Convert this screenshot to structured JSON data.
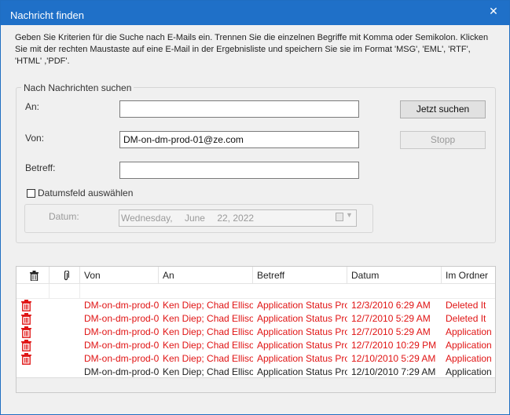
{
  "window": {
    "title": "Nachricht finden",
    "close_glyph": "✕"
  },
  "instructions": "Geben Sie Kriterien für die Suche nach E-Mails ein. Trennen Sie die einzelnen Begriffe mit Komma oder Semikolon. Klicken Sie mit der rechten Maustaste auf eine E-Mail in der Ergebnisliste und speichern Sie sie im Format 'MSG', 'EML', 'RTF', 'HTML' ,'PDF'.",
  "search": {
    "group_label": "Nach Nachrichten suchen",
    "to_label": "An:",
    "to_value": "",
    "from_label": "Von:",
    "from_value": "DM-on-dm-prod-01@ze.com",
    "subject_label": "Betreff:",
    "subject_value": "",
    "date_checkbox_label": "Datumsfeld auswählen",
    "date_checked": false,
    "date_label": "Datum:",
    "date_weekday": "Wednesday,",
    "date_month": "June",
    "date_day_year": "22, 2022",
    "search_button": "Jetzt suchen",
    "stop_button": "Stopp"
  },
  "results": {
    "columns": [
      "Von",
      "An",
      "Betreff",
      "Datum",
      "Im Ordner"
    ],
    "colors": {
      "deleted": "#e01414",
      "normal": "#222222"
    },
    "rows": [
      {
        "deleted": true,
        "from": "DM-on-dm-prod-0...",
        "to": "Ken Diep; Chad Elliso...",
        "subject": "Application Status Pro...",
        "date": "12/3/2010 6:29 AM",
        "folder": "Deleted It"
      },
      {
        "deleted": true,
        "from": "DM-on-dm-prod-0...",
        "to": "Ken Diep; Chad Elliso...",
        "subject": "Application Status Pro...",
        "date": "12/7/2010 5:29 AM",
        "folder": "Deleted It"
      },
      {
        "deleted": true,
        "from": "DM-on-dm-prod-0...",
        "to": "Ken Diep; Chad Elliso...",
        "subject": "Application Status Pro...",
        "date": "12/7/2010 5:29 AM",
        "folder": "Application"
      },
      {
        "deleted": true,
        "from": "DM-on-dm-prod-0...",
        "to": "Ken Diep; Chad Elliso...",
        "subject": "Application Status Pro...",
        "date": "12/7/2010 10:29 PM",
        "folder": "Application"
      },
      {
        "deleted": true,
        "from": "DM-on-dm-prod-0...",
        "to": "Ken Diep; Chad Elliso...",
        "subject": "Application Status Pro...",
        "date": "12/10/2010 5:29 AM",
        "folder": "Application"
      },
      {
        "deleted": false,
        "from": "DM-on-dm-prod-0...",
        "to": "Ken Diep; Chad Elliso...",
        "subject": "Application Status Pro...",
        "date": "12/10/2010 7:29 AM",
        "folder": "Application"
      }
    ]
  }
}
